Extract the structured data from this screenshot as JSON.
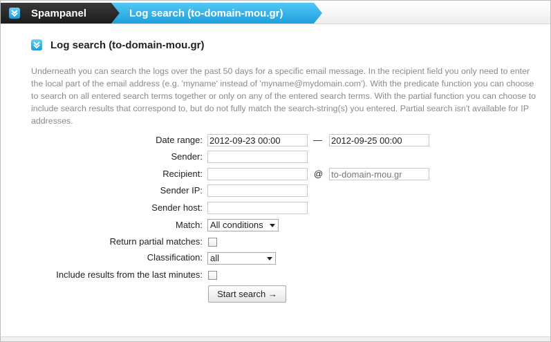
{
  "breadcrumb": {
    "home": "Spampanel",
    "current": "Log search (to-domain-mou.gr)"
  },
  "section": {
    "title": "Log search (to-domain-mou.gr)",
    "intro": "Underneath you can search the logs over the past 50 days for a specific email message. In the recipient field you only need to enter the local part of the email address (e.g. 'myname' instead of 'myname@mydomain.com'). With the predicate function you can choose to search on all entered search terms together or only on any of the entered search terms. With the partial function you can choose to include search results that correspond to, but do not fully match the search-string(s) you entered. Partial search isn't available for IP addresses."
  },
  "form": {
    "date_range_label": "Date range:",
    "date_from": "2012-09-23 00:00",
    "date_separator": "—",
    "date_to": "2012-09-25 00:00",
    "sender_label": "Sender:",
    "sender_value": "",
    "recipient_label": "Recipient:",
    "recipient_value": "",
    "at_sign": "@",
    "recipient_domain": "to-domain-mou.gr",
    "sender_ip_label": "Sender IP:",
    "sender_ip_value": "",
    "sender_host_label": "Sender host:",
    "sender_host_value": "",
    "match_label": "Match:",
    "match_value": "All conditions",
    "partial_label": "Return partial matches:",
    "partial_checked": false,
    "classification_label": "Classification:",
    "classification_value": "all",
    "last_minutes_label": "Include results from the last minutes:",
    "last_minutes_checked": false,
    "submit_label": "Start search →"
  },
  "colors": {
    "accent_blue": "#1f9fdb",
    "breadcrumb_dark": "#2a2a2a",
    "intro_text": "#8a8a8a"
  },
  "icons": {
    "breadcrumb": "chevron-double-down-icon",
    "section": "chevron-double-down-icon"
  }
}
